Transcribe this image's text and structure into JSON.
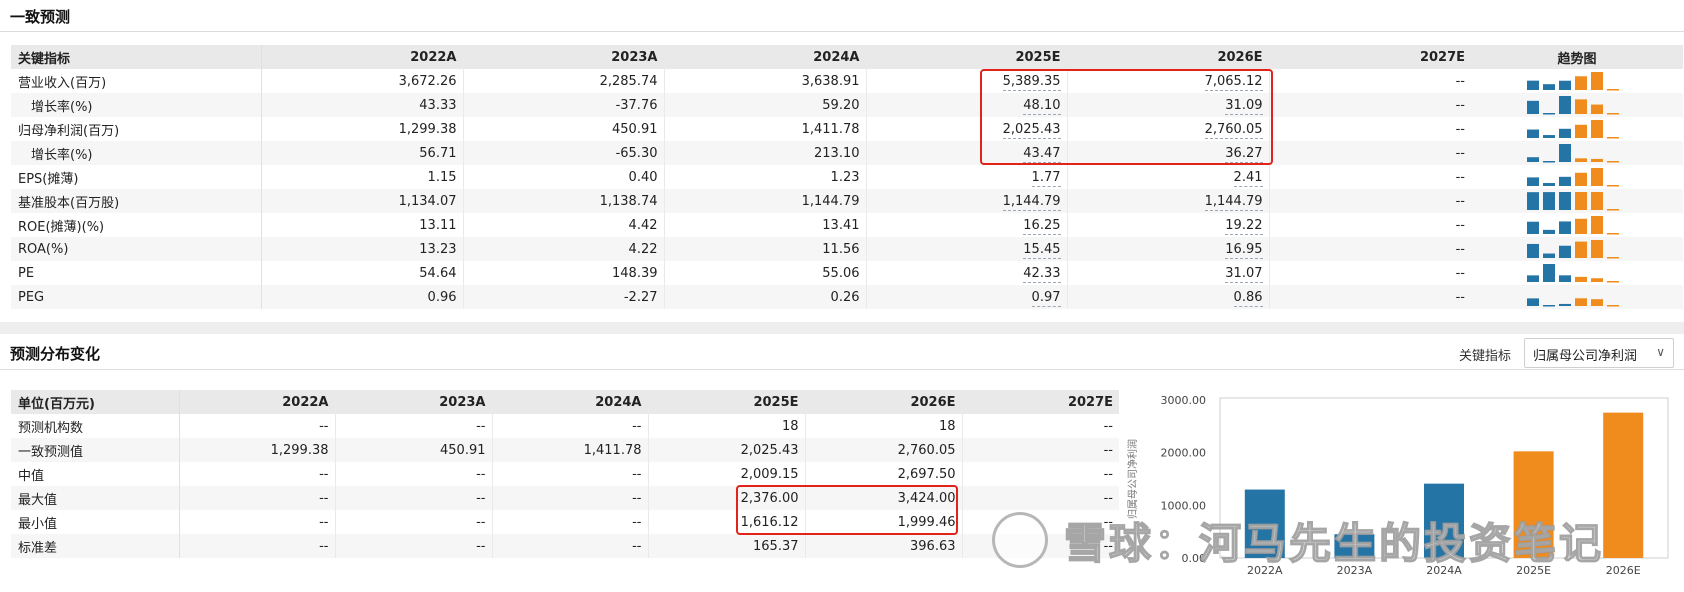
{
  "section1": {
    "title": "一致预测",
    "headers": [
      "关键指标",
      "2022A",
      "2023A",
      "2024A",
      "2025E",
      "2026E",
      "2027E",
      "趋势图"
    ],
    "rows": [
      {
        "label": "营业收入(百万)",
        "sub": false,
        "values": [
          "3,672.26",
          "2,285.74",
          "3,638.91",
          "5,389.35",
          "7,065.12",
          "--"
        ],
        "trend": [
          3672.26,
          2285.74,
          3638.91,
          5389.35,
          7065.12,
          0
        ]
      },
      {
        "label": "增长率(%)",
        "sub": true,
        "values": [
          "43.33",
          "-37.76",
          "59.20",
          "48.10",
          "31.09",
          "--"
        ],
        "trend": [
          43.33,
          -37.76,
          59.2,
          48.1,
          31.09,
          0
        ]
      },
      {
        "label": "归母净利润(百万)",
        "sub": false,
        "values": [
          "1,299.38",
          "450.91",
          "1,411.78",
          "2,025.43",
          "2,760.05",
          "--"
        ],
        "trend": [
          1299.38,
          450.91,
          1411.78,
          2025.43,
          2760.05,
          0
        ]
      },
      {
        "label": "增长率(%)",
        "sub": true,
        "values": [
          "56.71",
          "-65.30",
          "213.10",
          "43.47",
          "36.27",
          "--"
        ],
        "trend": [
          56.71,
          -65.3,
          213.1,
          43.47,
          36.27,
          0
        ]
      },
      {
        "label": "EPS(摊薄)",
        "sub": false,
        "values": [
          "1.15",
          "0.40",
          "1.23",
          "1.77",
          "2.41",
          "--"
        ],
        "trend": [
          1.15,
          0.4,
          1.23,
          1.77,
          2.41,
          0
        ]
      },
      {
        "label": "基准股本(百万股)",
        "sub": false,
        "values": [
          "1,134.07",
          "1,138.74",
          "1,144.79",
          "1,144.79",
          "1,144.79",
          "--"
        ],
        "trend": [
          1134.07,
          1138.74,
          1144.79,
          1144.79,
          1144.79,
          0
        ]
      },
      {
        "label": "ROE(摊薄)(%)",
        "sub": false,
        "values": [
          "13.11",
          "4.42",
          "13.41",
          "16.25",
          "19.22",
          "--"
        ],
        "trend": [
          13.11,
          4.42,
          13.41,
          16.25,
          19.22,
          0
        ]
      },
      {
        "label": "ROA(%)",
        "sub": false,
        "values": [
          "13.23",
          "4.22",
          "11.56",
          "15.45",
          "16.95",
          "--"
        ],
        "trend": [
          13.23,
          4.22,
          11.56,
          15.45,
          16.95,
          0
        ]
      },
      {
        "label": "PE",
        "sub": false,
        "values": [
          "54.64",
          "148.39",
          "55.06",
          "42.33",
          "31.07",
          "--"
        ],
        "trend": [
          54.64,
          148.39,
          55.06,
          42.33,
          31.07,
          0
        ]
      },
      {
        "label": "PEG",
        "sub": false,
        "values": [
          "0.96",
          "-2.27",
          "0.26",
          "0.97",
          "0.86",
          "--"
        ],
        "trend": [
          0.96,
          -2.27,
          0.26,
          0.97,
          0.86,
          0
        ]
      }
    ]
  },
  "section2": {
    "title": "预测分布变化",
    "selector_label": "关键指标",
    "selector_value": "归属母公司净利润",
    "headers": [
      "单位(百万元)",
      "2022A",
      "2023A",
      "2024A",
      "2025E",
      "2026E",
      "2027E"
    ],
    "rows": [
      {
        "label": "预测机构数",
        "values": [
          "--",
          "--",
          "--",
          "18",
          "18",
          "--"
        ]
      },
      {
        "label": "一致预测值",
        "values": [
          "1,299.38",
          "450.91",
          "1,411.78",
          "2,025.43",
          "2,760.05",
          "--"
        ]
      },
      {
        "label": "中值",
        "values": [
          "--",
          "--",
          "--",
          "2,009.15",
          "2,697.50",
          "--"
        ]
      },
      {
        "label": "最大值",
        "values": [
          "--",
          "--",
          "--",
          "2,376.00",
          "3,424.00",
          "--"
        ]
      },
      {
        "label": "最小值",
        "values": [
          "--",
          "--",
          "--",
          "1,616.12",
          "1,999.46",
          "--"
        ]
      },
      {
        "label": "标准差",
        "values": [
          "--",
          "--",
          "--",
          "165.37",
          "396.63",
          "--"
        ]
      }
    ]
  },
  "colors": {
    "actual": "#2475a5",
    "estimate": "#f08c1e",
    "highlight": "#e2231a"
  },
  "watermark": "雪球：河马先生的投资笔记",
  "chart_data": {
    "type": "bar",
    "categories": [
      "2022A",
      "2023A",
      "2024A",
      "2025E",
      "2026E"
    ],
    "values": [
      1299.38,
      450.91,
      1411.78,
      2025.43,
      2760.05
    ],
    "ylabel": "归属母公司净利润",
    "y_ticks": [
      "0.00",
      "1000.00",
      "2000.00",
      "3000.00"
    ],
    "ylim": [
      0,
      3000
    ],
    "grid": false,
    "estimate_from_index": 3
  }
}
